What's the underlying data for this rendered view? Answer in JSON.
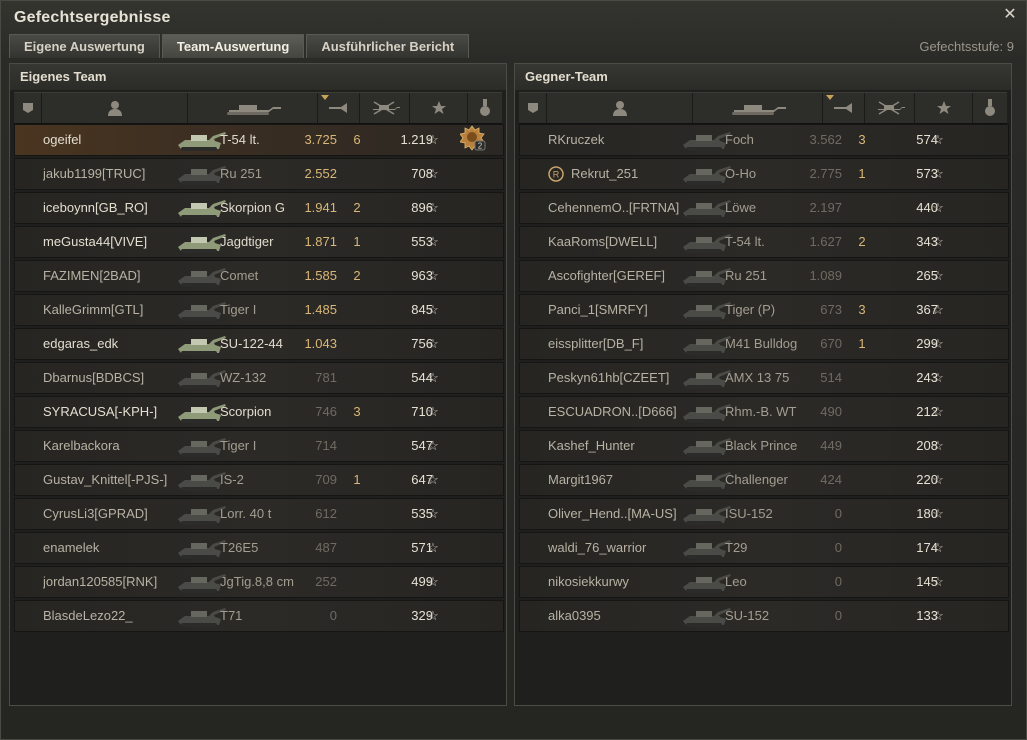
{
  "window": {
    "title": "Gefechtsergebnisse",
    "level_label": "Gefechtsstufe: 9"
  },
  "tabs": [
    {
      "label": "Eigene Auswertung"
    },
    {
      "label": "Team-Auswertung"
    },
    {
      "label": "Ausführlicher Bericht"
    }
  ],
  "teams": {
    "own": {
      "title": "Eigenes Team",
      "rows": [
        {
          "player": "ogeifel",
          "vehicle": "T-54 lt.",
          "damage": "3.725",
          "kills": "6",
          "xp": "1.219"
        },
        {
          "player": "jakub1199[TRUC]",
          "vehicle": "Ru 251",
          "damage": "2.552",
          "kills": "",
          "xp": "708"
        },
        {
          "player": "iceboynn[GB_RO]",
          "vehicle": "Skorpion G",
          "damage": "1.941",
          "kills": "2",
          "xp": "896"
        },
        {
          "player": "meGusta44[VIVE]",
          "vehicle": "Jagdtiger",
          "damage": "1.871",
          "kills": "1",
          "xp": "553"
        },
        {
          "player": "FAZIMEN[2BAD]",
          "vehicle": "Comet",
          "damage": "1.585",
          "kills": "2",
          "xp": "963"
        },
        {
          "player": "KalleGrimm[GTL]",
          "vehicle": "Tiger I",
          "damage": "1.485",
          "kills": "",
          "xp": "845"
        },
        {
          "player": "edgaras_edk",
          "vehicle": "SU-122-44",
          "damage": "1.043",
          "kills": "",
          "xp": "756"
        },
        {
          "player": "Dbarnus[BDBCS]",
          "vehicle": "WZ-132",
          "damage": "781",
          "kills": "",
          "xp": "544"
        },
        {
          "player": "SYRACUSA[-KPH-]",
          "vehicle": "Scorpion",
          "damage": "746",
          "kills": "3",
          "xp": "710"
        },
        {
          "player": "Karelbackora",
          "vehicle": "Tiger I",
          "damage": "714",
          "kills": "",
          "xp": "547"
        },
        {
          "player": "Gustav_Knittel[-PJS-]",
          "vehicle": "IS-2",
          "damage": "709",
          "kills": "1",
          "xp": "647"
        },
        {
          "player": "CyrusLi3[GPRAD]",
          "vehicle": "Lorr. 40 t",
          "damage": "612",
          "kills": "",
          "xp": "535"
        },
        {
          "player": "enamelek",
          "vehicle": "T26E5",
          "damage": "487",
          "kills": "",
          "xp": "571"
        },
        {
          "player": "jordan120585[RNK]",
          "vehicle": "JgTig.8,8 cm",
          "damage": "252",
          "kills": "",
          "xp": "499"
        },
        {
          "player": "BlasdeLezo22_",
          "vehicle": "T71",
          "damage": "0",
          "kills": "",
          "xp": "329"
        }
      ],
      "medal_count": "2"
    },
    "enemy": {
      "title": "Gegner-Team",
      "rows": [
        {
          "player": "RKruczek",
          "vehicle": "Foch",
          "damage": "3.562",
          "kills": "3",
          "xp": "574"
        },
        {
          "player": "Rekrut_251",
          "vehicle": "O-Ho",
          "damage": "2.775",
          "kills": "1",
          "xp": "573"
        },
        {
          "player": "CehennemO..[FRTNA]",
          "vehicle": "Löwe",
          "damage": "2.197",
          "kills": "",
          "xp": "440"
        },
        {
          "player": "KaaRoms[DWELL]",
          "vehicle": "T-54 lt.",
          "damage": "1.627",
          "kills": "2",
          "xp": "343"
        },
        {
          "player": "Ascofighter[GEREF]",
          "vehicle": "Ru 251",
          "damage": "1.089",
          "kills": "",
          "xp": "265"
        },
        {
          "player": "Panci_1[SMRFY]",
          "vehicle": "Tiger (P)",
          "damage": "673",
          "kills": "3",
          "xp": "367"
        },
        {
          "player": "eissplitter[DB_F]",
          "vehicle": "M41 Bulldog",
          "damage": "670",
          "kills": "1",
          "xp": "299"
        },
        {
          "player": "Peskyn61hb[CZEET]",
          "vehicle": "AMX 13 75",
          "damage": "514",
          "kills": "",
          "xp": "243"
        },
        {
          "player": "ESCUADRON..[D666]",
          "vehicle": "Rhm.-B. WT",
          "damage": "490",
          "kills": "",
          "xp": "212"
        },
        {
          "player": "Kashef_Hunter",
          "vehicle": "Black Prince",
          "damage": "449",
          "kills": "",
          "xp": "208"
        },
        {
          "player": "Margit1967",
          "vehicle": "Challenger",
          "damage": "424",
          "kills": "",
          "xp": "220"
        },
        {
          "player": "Oliver_Hend..[MA-US]",
          "vehicle": "ISU-152",
          "damage": "0",
          "kills": "",
          "xp": "180"
        },
        {
          "player": "waldi_76_warrior",
          "vehicle": "T29",
          "damage": "0",
          "kills": "",
          "xp": "174"
        },
        {
          "player": "nikosiekkurwy",
          "vehicle": "Leo",
          "damage": "0",
          "kills": "",
          "xp": "145"
        },
        {
          "player": "alka0395",
          "vehicle": "SU-152",
          "damage": "0",
          "kills": "",
          "xp": "133"
        }
      ]
    }
  },
  "star_glyph": "☆",
  "close_glyph": "✕",
  "colors": {
    "highlight_row": "#4a3520",
    "damage_high": "#d9b777",
    "damage_low": "#6f6b62"
  }
}
